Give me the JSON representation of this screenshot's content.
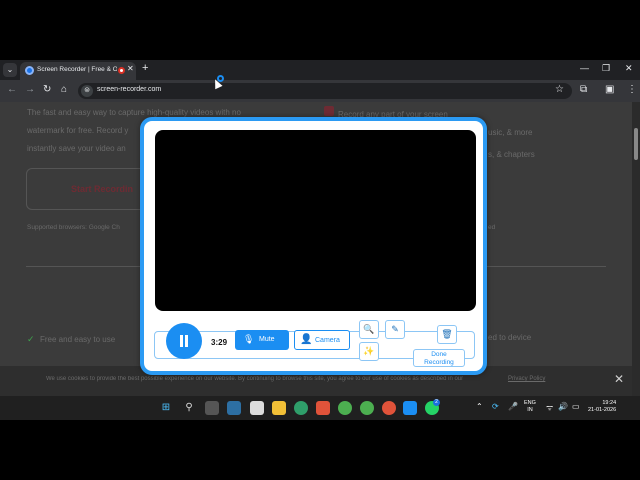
{
  "browser": {
    "tab_title": "Screen Recorder | Free & O",
    "url": "screen-recorder.com",
    "tab_list_glyph": "⌄",
    "tab_close_glyph": "✕",
    "new_tab_glyph": "+",
    "window_controls": {
      "minimize": "—",
      "maximize": "❐",
      "close": "✕"
    },
    "nav_glyphs": {
      "back": "←",
      "forward": "→",
      "reload": "↻",
      "home": "⌂"
    },
    "site_info_glyph": "⊜",
    "bookmark_glyph": "☆",
    "extensions_glyph": "⧉",
    "profile_glyph": "▣",
    "menu_glyph": "⋮"
  },
  "page": {
    "line1": "The fast and easy way to capture high-quality videos with no",
    "line2": "watermark for free. Record y",
    "line3": "instantly save your video an",
    "start_button": "Start Recordin",
    "supported": "Supported browsers: Google Ch",
    "right1": "Record any part of your screen",
    "right2": "usic, & more",
    "right3": "s, & chapters",
    "right4": "ed",
    "feature_left": "Free and easy to use",
    "feature_right": "ed to device",
    "cookie_text": "We use cookies to provide the best possible experience on our website. By continuing to browse this site, you agree to our use of cookies as described in our",
    "cookie_policy": "Privacy Policy",
    "cookie_close": "✕"
  },
  "recorder": {
    "timer": "3:29",
    "mute_label": "Mute",
    "camera_label": "Camera",
    "done_line1": "Done",
    "done_line2": "Recording",
    "icons": {
      "mic": "🎙",
      "camera": "👤",
      "zoom": "🔍",
      "draw": "✎",
      "effects": "✨",
      "trash": "🗑"
    }
  },
  "taskbar": {
    "apps": [
      "windows-start",
      "search",
      "task-view",
      "widgets",
      "file-explorer",
      "edge",
      "brave",
      "chrome",
      "chrome",
      "chrome",
      "vscode",
      "whatsapp"
    ],
    "whatsapp_badge": "2",
    "tray_chevron": "⌃",
    "lang_line1": "ENG",
    "lang_line2": "IN",
    "time": "19:24",
    "date": "21-01-2026"
  },
  "colors": {
    "accent": "#1b8ef2",
    "modal_border": "#2b9af3",
    "brand": "#6e2b33"
  }
}
